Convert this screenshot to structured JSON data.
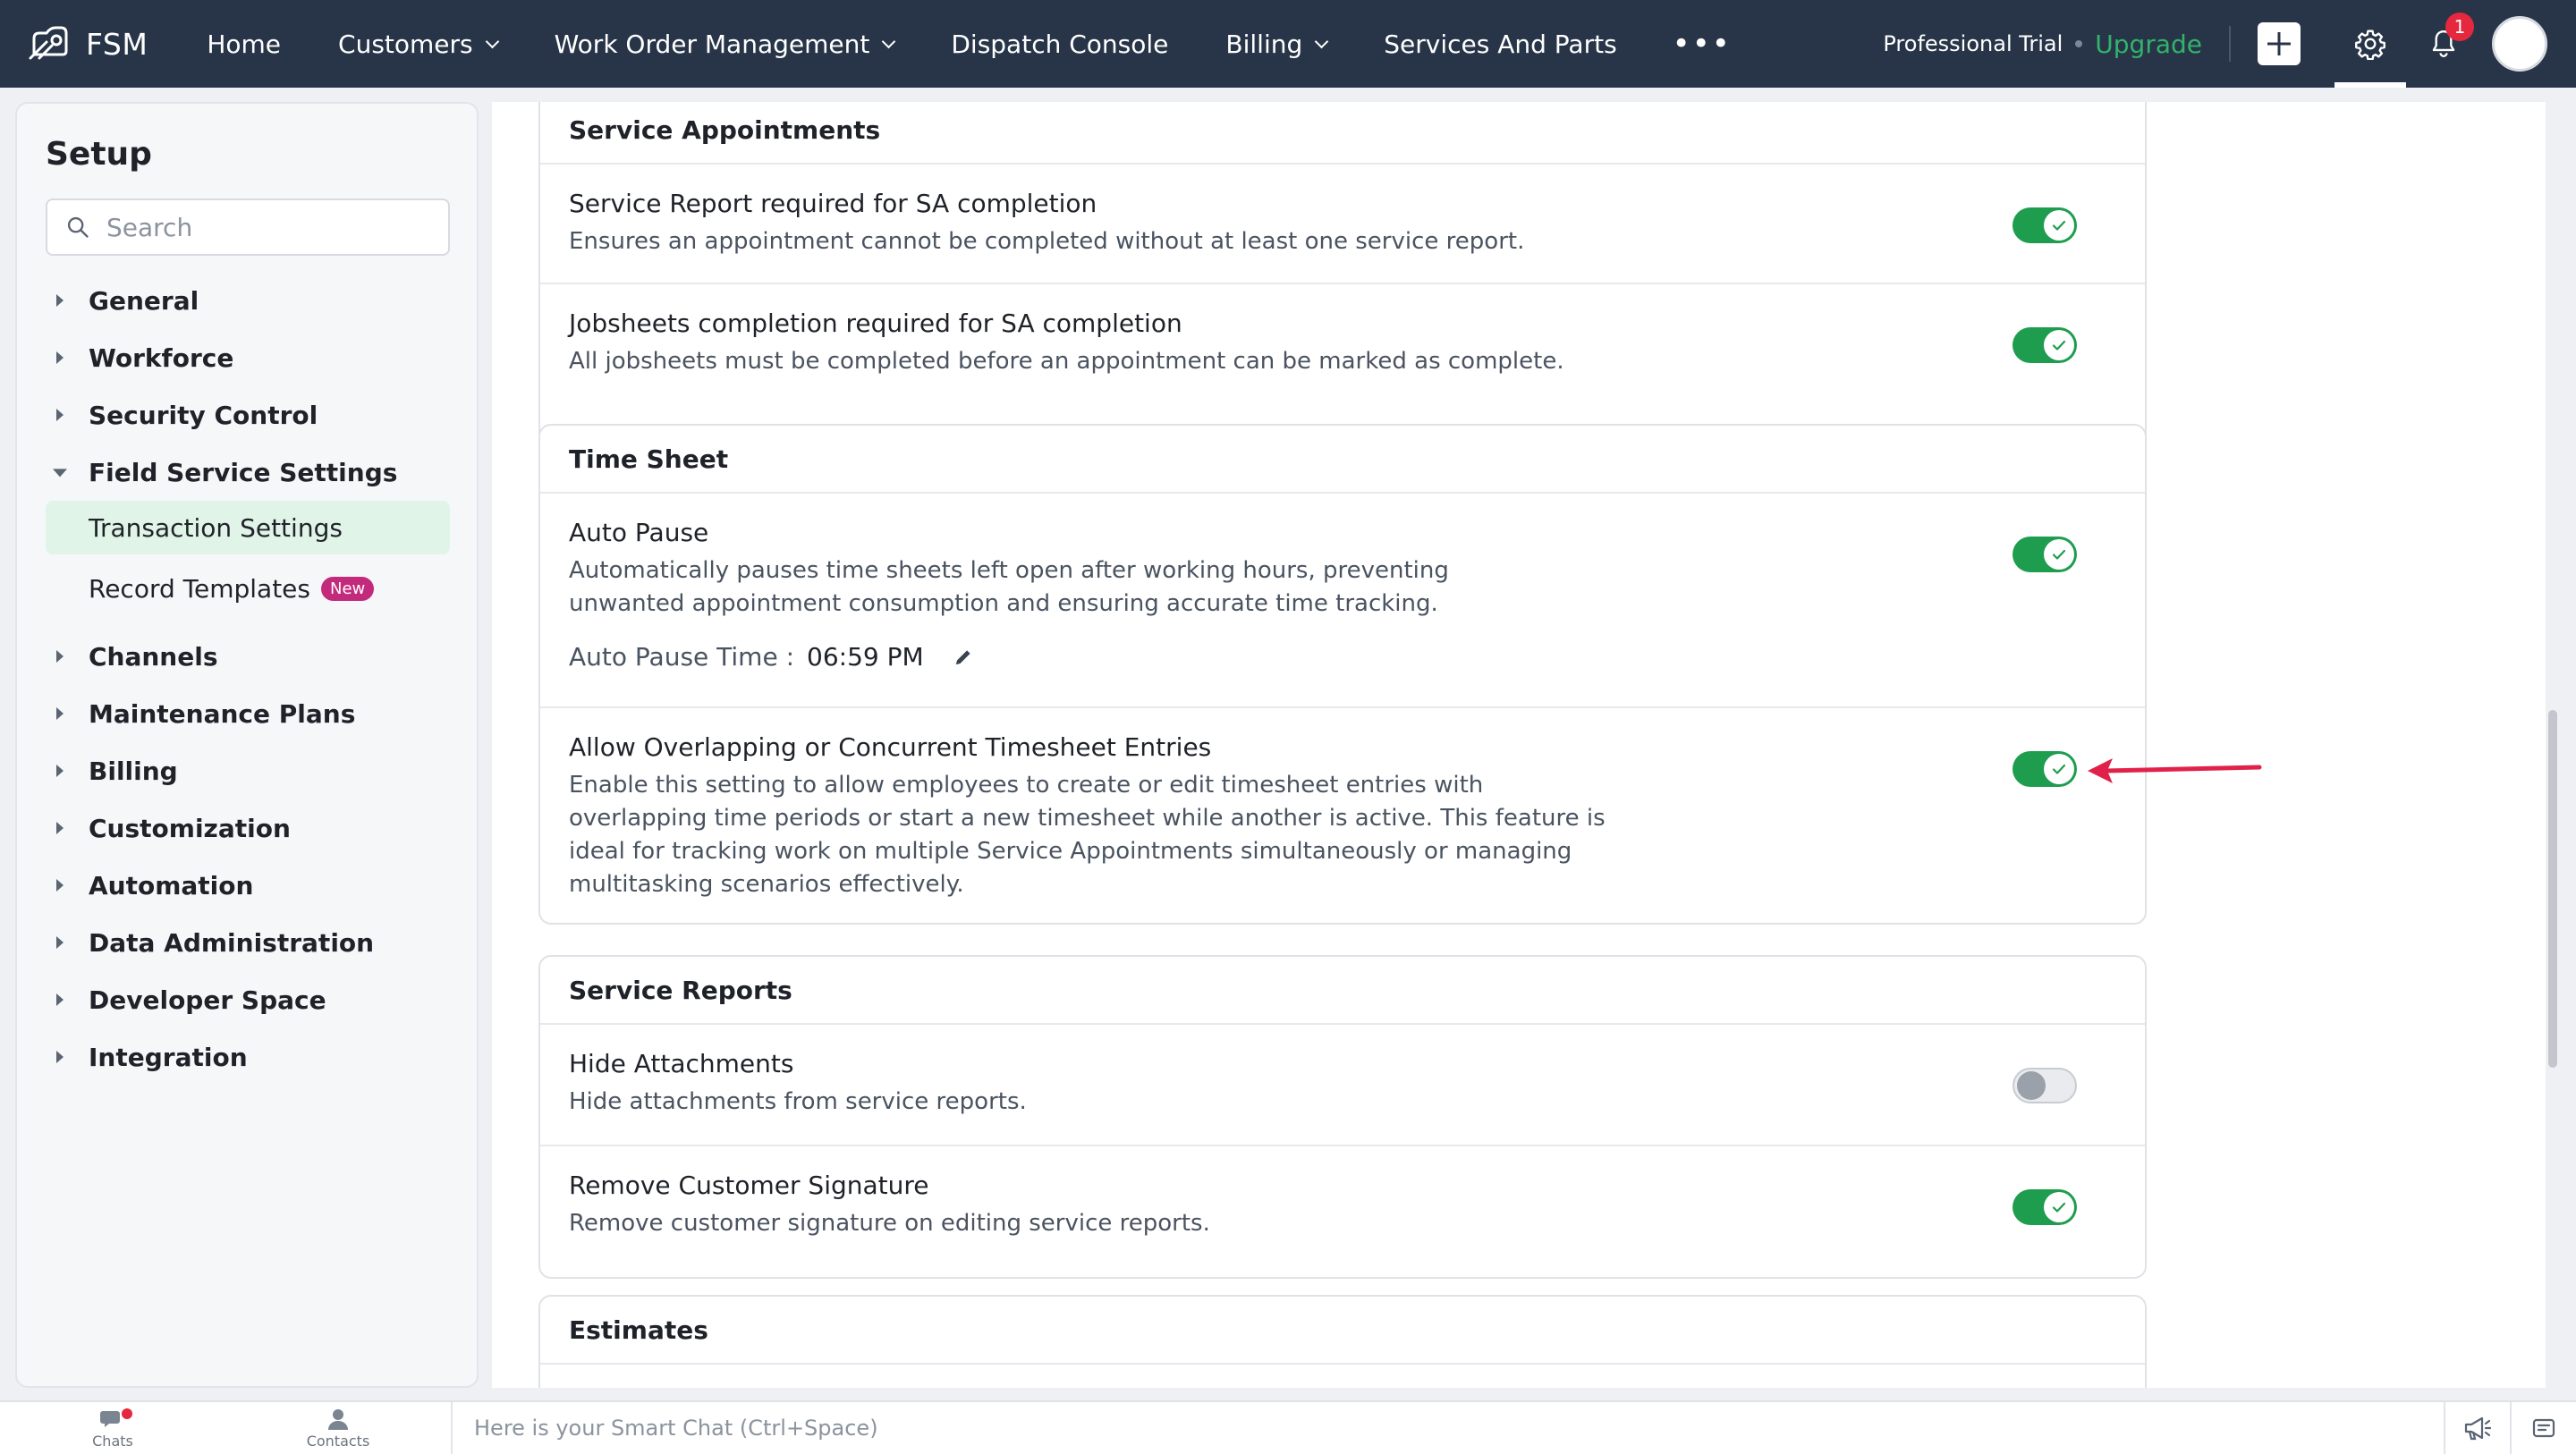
{
  "topnav": {
    "brand": "FSM",
    "items": [
      {
        "label": "Home",
        "dropdown": false
      },
      {
        "label": "Customers",
        "dropdown": true
      },
      {
        "label": "Work Order Management",
        "dropdown": true
      },
      {
        "label": "Dispatch Console",
        "dropdown": false
      },
      {
        "label": "Billing",
        "dropdown": true
      },
      {
        "label": "Services And Parts",
        "dropdown": false
      }
    ],
    "more": "•••",
    "trial_label": "Professional Trial",
    "upgrade_label": "Upgrade",
    "notification_count": "1"
  },
  "sidebar": {
    "title": "Setup",
    "search_placeholder": "Search",
    "menu": [
      {
        "label": "General"
      },
      {
        "label": "Workforce"
      },
      {
        "label": "Security Control"
      },
      {
        "label": "Field Service Settings"
      },
      {
        "label": "Transaction Settings"
      },
      {
        "label": "Record Templates",
        "badge": "New"
      },
      {
        "label": "Channels"
      },
      {
        "label": "Maintenance Plans"
      },
      {
        "label": "Billing"
      },
      {
        "label": "Customization"
      },
      {
        "label": "Automation"
      },
      {
        "label": "Data Administration"
      },
      {
        "label": "Developer Space"
      },
      {
        "label": "Integration"
      }
    ]
  },
  "sections": {
    "service_appointments": {
      "title": "Service Appointments",
      "rows": [
        {
          "title": "Service Report required for SA completion",
          "desc": "Ensures an appointment cannot be completed without at least one service report.",
          "enabled": true
        },
        {
          "title": "Jobsheets completion required for SA completion",
          "desc": "All jobsheets must be completed before an appointment can be marked as complete.",
          "enabled": true
        }
      ]
    },
    "time_sheet": {
      "title": "Time Sheet",
      "rows": [
        {
          "title": "Auto Pause",
          "desc": "Automatically pauses time sheets left open after working hours, preventing unwanted appointment consumption and ensuring accurate time tracking.",
          "enabled": true,
          "auto_pause_label": "Auto Pause Time :",
          "auto_pause_value": "06:59 PM"
        },
        {
          "title": "Allow Overlapping or Concurrent Timesheet Entries",
          "desc": "Enable this setting to allow employees to create or edit timesheet entries with overlapping time periods or start a new timesheet while another is active. This feature is ideal for tracking work on multiple Service Appointments simultaneously or managing multitasking scenarios effectively.",
          "enabled": true
        }
      ]
    },
    "service_reports": {
      "title": "Service Reports",
      "rows": [
        {
          "title": "Hide Attachments",
          "desc": "Hide attachments from service reports.",
          "enabled": false
        },
        {
          "title": "Remove Customer Signature",
          "desc": "Remove customer signature on editing service reports.",
          "enabled": true
        }
      ]
    },
    "estimates": {
      "title": "Estimates"
    }
  },
  "bottombar": {
    "chats_label": "Chats",
    "contacts_label": "Contacts",
    "smart_chat_placeholder": "Here is your Smart Chat (Ctrl+Space)"
  },
  "colors": {
    "nav_bg": "#283548",
    "toggle_on": "#1e9d4f",
    "upgrade": "#31b36b",
    "active_item_bg": "#e1f4e8",
    "badge_new": "#c42a7b",
    "annotation_arrow": "#e0224a"
  }
}
